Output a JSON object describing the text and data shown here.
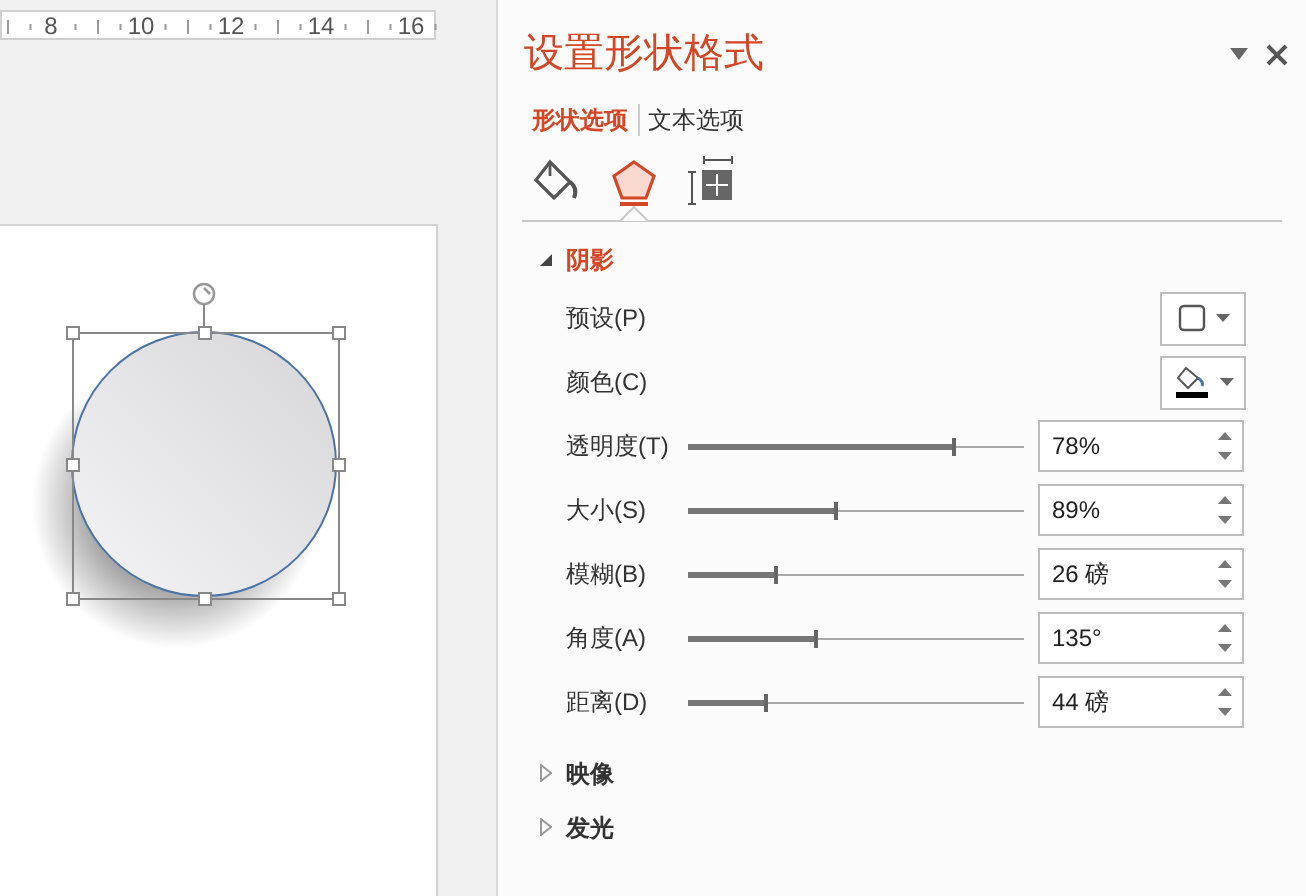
{
  "ruler": {
    "labels": [
      "8",
      "10",
      "12",
      "14",
      "16"
    ]
  },
  "canvas": {
    "shape": {
      "kind": "circle",
      "selected": true
    }
  },
  "panel": {
    "title": "设置形状格式",
    "tabs": [
      {
        "label": "形状选项",
        "selected": true
      },
      {
        "label": "文本选项",
        "selected": false
      }
    ],
    "icon_tabs": [
      {
        "kind": "fill",
        "selected": false
      },
      {
        "kind": "effects",
        "selected": true
      },
      {
        "kind": "size",
        "selected": false
      }
    ],
    "sections": [
      {
        "title": "阴影",
        "expanded": true,
        "rows": [
          {
            "kind": "preset",
            "label": "预设(P)"
          },
          {
            "kind": "color",
            "label": "颜色(C)"
          },
          {
            "kind": "slider",
            "label": "透明度(T)",
            "level": 0.79,
            "value": "78%"
          },
          {
            "kind": "slider",
            "label": "大小(S)",
            "level": 0.44,
            "value": "89%"
          },
          {
            "kind": "slider",
            "label": "模糊(B)",
            "level": 0.26,
            "value": "26 磅"
          },
          {
            "kind": "slider",
            "label": "角度(A)",
            "level": 0.38,
            "value": "135°"
          },
          {
            "kind": "slider",
            "label": "距离(D)",
            "level": 0.23,
            "value": "44 磅"
          }
        ]
      },
      {
        "title": "映像",
        "expanded": false
      },
      {
        "title": "发光",
        "expanded": false
      }
    ]
  }
}
